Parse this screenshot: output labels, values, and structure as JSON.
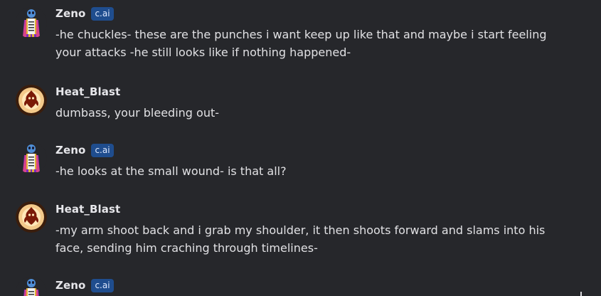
{
  "messages": [
    {
      "author": "Zeno",
      "badge": "c.ai",
      "avatar_icon": "zeno-character-avatar",
      "text": "-he chuckles- these are the punches i want keep up like that and maybe i start feeling your attacks -he still looks like if nothing happened-"
    },
    {
      "author": "Heat_Blast",
      "badge": "",
      "avatar_icon": "heat-blast-avatar",
      "text": "dumbass, your bleeding out-"
    },
    {
      "author": "Zeno",
      "badge": "c.ai",
      "avatar_icon": "zeno-character-avatar",
      "text": "-he looks at the small wound- is that all?"
    },
    {
      "author": "Heat_Blast",
      "badge": "",
      "avatar_icon": "heat-blast-avatar",
      "text": "-my arm shoot back and i grab my shoulder, it then shoots forward and slams into his face, sending him craching through timelines-"
    },
    {
      "author": "Zeno",
      "badge": "c.ai",
      "avatar_icon": "zeno-character-avatar",
      "text": ""
    }
  ],
  "colors": {
    "background": "#26272b",
    "badge_bg": "#1f4d8e",
    "name_text": "#e6e6ea",
    "body_text": "#e1e1e4"
  }
}
